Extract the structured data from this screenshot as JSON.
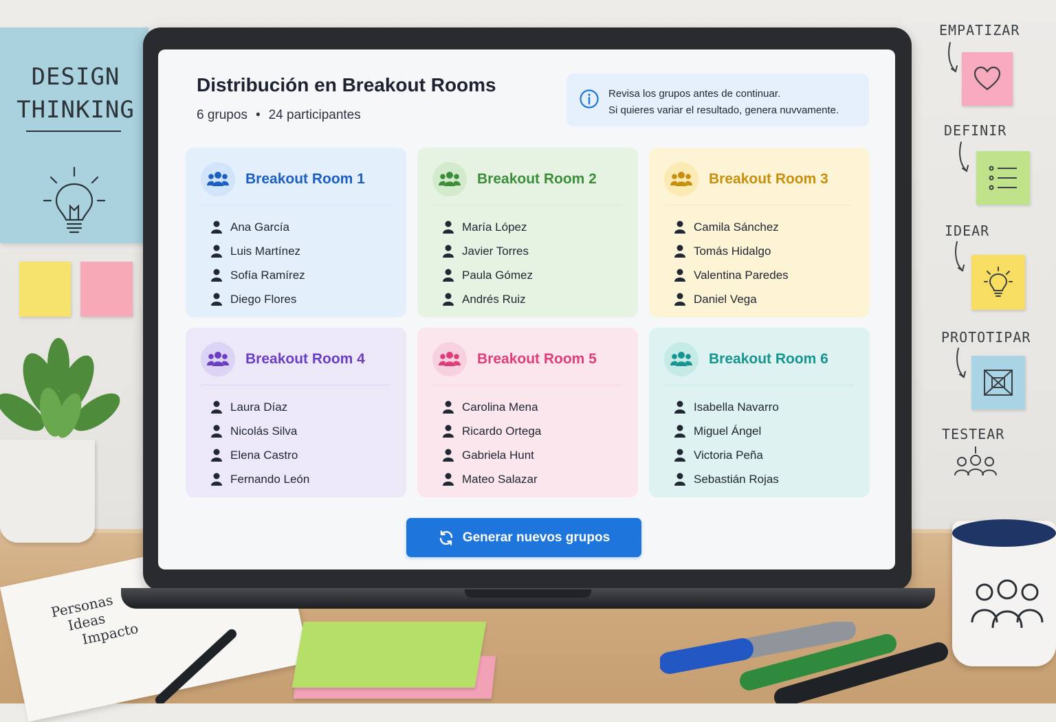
{
  "screen": {
    "title": "Distribución en Breakout Rooms",
    "summary": {
      "groups": "6 grupos",
      "separator": "•",
      "participants": "24 participantes"
    },
    "info": {
      "icon": "info-icon",
      "line1": "Revisa los grupos antes de continuar.",
      "line2": "Si quieres variar el resultado, genera nuvvamente."
    },
    "rooms": [
      {
        "name": "Breakout Room 1",
        "accent": "#1d5fc1",
        "bg": "#e4effc",
        "avatar_bg": "#d2e4fa",
        "members": [
          "Ana García",
          "Luis Martínez",
          "Sofía Ramírez",
          "Diego Flores"
        ]
      },
      {
        "name": "Breakout Room 2",
        "accent": "#3c8d3a",
        "bg": "#e6f3e2",
        "avatar_bg": "#d4eacd",
        "members": [
          "María López",
          "Javier Torres",
          "Paula Gómez",
          "Andrés Ruiz"
        ]
      },
      {
        "name": "Breakout Room 3",
        "accent": "#c6900e",
        "bg": "#fdf4d6",
        "avatar_bg": "#fbeab4",
        "members": [
          "Camila Sánchez",
          "Tomás Hidalgo",
          "Valentina Paredes",
          "Daniel Vega"
        ]
      },
      {
        "name": "Breakout Room 4",
        "accent": "#6a3fc2",
        "bg": "#ede8f8",
        "avatar_bg": "#ddd3f4",
        "members": [
          "Laura Díaz",
          "Nicolás Silva",
          "Elena Castro",
          "Fernando León"
        ]
      },
      {
        "name": "Breakout Room 5",
        "accent": "#dd3e7a",
        "bg": "#fbe6ee",
        "avatar_bg": "#f7d1df",
        "members": [
          "Carolina Mena",
          "Ricardo Ortega",
          "Gabriela Hunt",
          "Mateo Salazar"
        ]
      },
      {
        "name": "Breakout Room 6",
        "accent": "#16948f",
        "bg": "#def3f1",
        "avatar_bg": "#c6ebe7",
        "members": [
          "Isabella Navarro",
          "Miguel Ángel",
          "Victoria Peña",
          "Sebastián Rojas"
        ]
      }
    ],
    "generate_button": {
      "label": "Generar nuevos grupos",
      "icon": "refresh-icon",
      "color": "#1e76dc"
    }
  },
  "wall": {
    "poster": {
      "line1": "DESIGN",
      "line2": "THINKING",
      "icon": "lightbulb-icon"
    },
    "steps": [
      {
        "label": "EMPATIZAR",
        "icon": "heart-icon",
        "note_color": "#f7a9bd"
      },
      {
        "label": "DEFINIR",
        "icon": "list-icon",
        "note_color": "#bfe28a"
      },
      {
        "label": "IDEAR",
        "icon": "lightbulb-icon",
        "note_color": "#f7de62"
      },
      {
        "label": "PROTOTIPAR",
        "icon": "prototype-icon",
        "note_color": "#a9d4e6"
      },
      {
        "label": "TESTEAR",
        "icon": "users-icon"
      }
    ]
  },
  "desk": {
    "notebook": {
      "lines": [
        "Personas",
        "Ideas",
        "Impacto"
      ]
    }
  }
}
